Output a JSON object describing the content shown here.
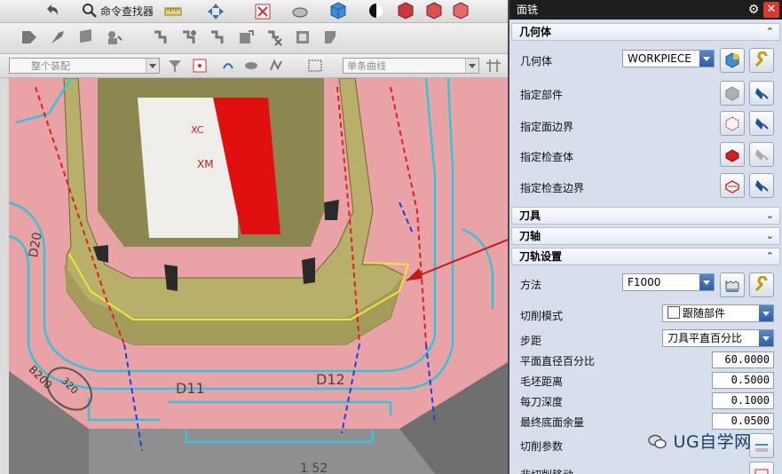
{
  "toolbar": {
    "command_finder": "命令查找器",
    "combo_select": "整个装配",
    "combo_curve": "单条曲线"
  },
  "viewport": {
    "axis_xc": "XC",
    "axis_xm": "XM",
    "labels": [
      "D20",
      "D11",
      "D12",
      "B200",
      "320"
    ],
    "partial_bottom": "1 52"
  },
  "panel": {
    "title": "面铣",
    "sections": {
      "geometry": "几何体",
      "tool": "刀具",
      "axis": "刀轴",
      "path": "刀轨设置"
    },
    "geometry": {
      "label": "几何体",
      "value": "WORKPIECE",
      "rows": [
        "指定部件",
        "指定面边界",
        "指定检查体",
        "指定检查边界"
      ]
    },
    "path": {
      "method_label": "方法",
      "method_value": "F1000",
      "cut_mode_label": "切削模式",
      "cut_mode_value": "跟随部件",
      "stepover_label": "步距",
      "stepover_value": "刀具平直百分比",
      "percent_label": "平面直径百分比",
      "percent_value": "60.0000",
      "blank_label": "毛坯距离",
      "blank_value": "0.5000",
      "depth_label": "每刀深度",
      "depth_value": "0.1000",
      "floor_label": "最终底面余量",
      "floor_value": "0.0500",
      "cut_params_label": "切削参数",
      "noncut_label": "非切削移动"
    },
    "watermark": "UG自学网",
    "colors": {
      "title_bg": "#1e1e1e",
      "panel_bg": "#d6dfeb",
      "part_pink": "#e8a3a6",
      "part_olive": "#b5ad67",
      "red_plate": "#e01010"
    }
  }
}
